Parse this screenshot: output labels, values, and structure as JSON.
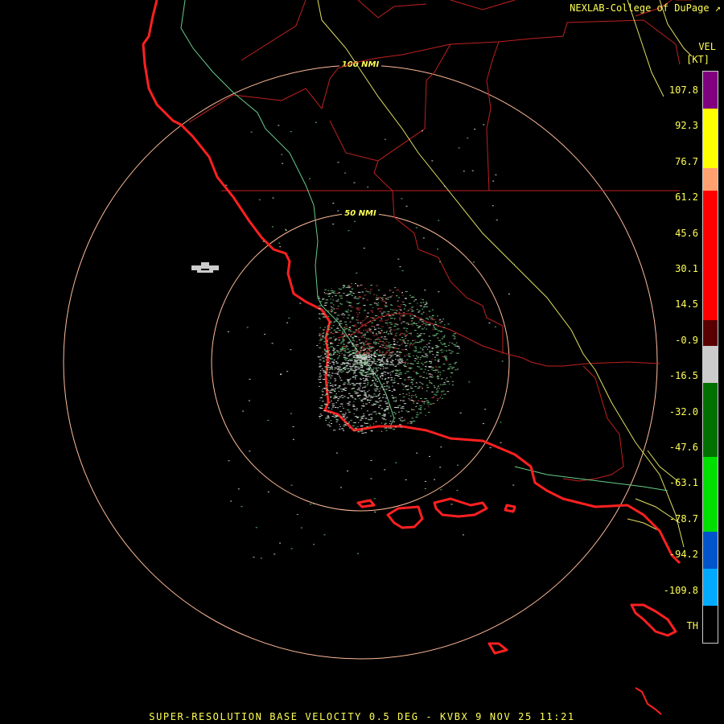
{
  "header": {
    "credit": "NEXLAB-College of DuPage"
  },
  "legend": {
    "product": "VEL",
    "unit": "[KT]",
    "ticks": [
      "107.8",
      "92.3",
      "76.7",
      "61.2",
      "45.6",
      "30.1",
      "14.5",
      "-0.9",
      "-16.5",
      "-32.0",
      "-47.6",
      "-63.1",
      "-78.7",
      "-94.2",
      "-109.8",
      "TH"
    ],
    "segments": [
      {
        "color": "#800080",
        "weight": 1
      },
      {
        "color": "#ffff00",
        "weight": 1.6
      },
      {
        "color": "#ffa070",
        "weight": 0.6
      },
      {
        "color": "#ff0000",
        "weight": 3.5
      },
      {
        "color": "#5a0000",
        "weight": 0.7
      },
      {
        "color": "#cccccc",
        "weight": 1
      },
      {
        "color": "#007000",
        "weight": 2
      },
      {
        "color": "#00e000",
        "weight": 2
      },
      {
        "color": "#0055cc",
        "weight": 1
      },
      {
        "color": "#00aaff",
        "weight": 1
      },
      {
        "color": "#000000",
        "weight": 1
      }
    ]
  },
  "map": {
    "rings": [
      {
        "label": "100 NMI"
      },
      {
        "label": "50 NMI"
      }
    ],
    "colors": {
      "coast": "#ff2020",
      "county": "#c02020",
      "highway_green": "#66cc88",
      "highway_yellow": "#e0e060",
      "ring": "#ffbb99",
      "echo_light": "#cccccc",
      "echo_green": "#66bb77",
      "echo_red": "#aa3333"
    }
  },
  "footer": {
    "caption": "SUPER-RESOLUTION BASE VELOCITY 0.5 DEG - KVBX 9 NOV 25 11:21"
  }
}
